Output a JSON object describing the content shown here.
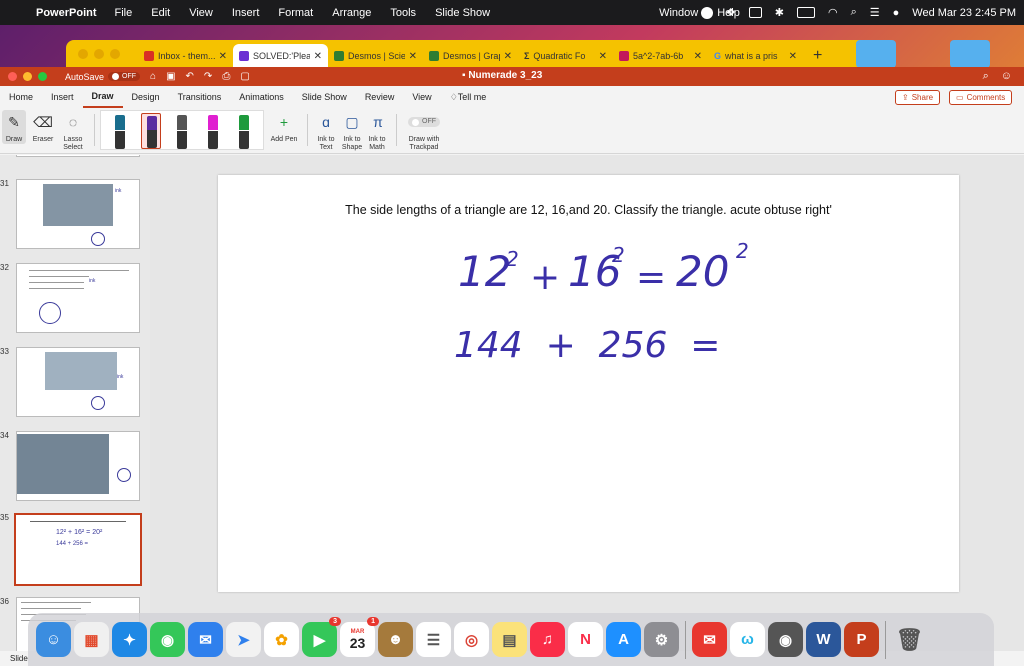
{
  "menubar": {
    "app_name": "PowerPoint",
    "menus": [
      "File",
      "Edit",
      "View",
      "Insert",
      "Format",
      "Arrange",
      "Tools",
      "Slide Show",
      "Window",
      "Help"
    ],
    "datetime": "Wed Mar 23  2:45 PM"
  },
  "browser": {
    "tabs": [
      {
        "label": "Inbox - them...",
        "fav_color": "#d93025"
      },
      {
        "label": "SOLVED:'Plea",
        "fav_color": "#6b2fd3"
      },
      {
        "label": "Desmos | Scie",
        "fav_color": "#2e7d32"
      },
      {
        "label": "Desmos | Grap",
        "fav_color": "#2e7d32"
      },
      {
        "label": "Quadratic Fo",
        "fav_color": "#333333"
      },
      {
        "label": "5a^2-7ab-6b",
        "fav_color": "#c2185b"
      },
      {
        "label": "what is a pris",
        "fav_color": "#4285f4"
      }
    ]
  },
  "ppt": {
    "autosave_label": "AutoSave",
    "autosave_state": "OFF",
    "doc_title": "Numerade 3_23",
    "ribbon_tabs": [
      "Home",
      "Insert",
      "Draw",
      "Design",
      "Transitions",
      "Animations",
      "Slide Show",
      "Review",
      "View"
    ],
    "active_tab": "Draw",
    "tell_me": "Tell me",
    "share_label": "Share",
    "comments_label": "Comments",
    "tools": {
      "draw": "Draw",
      "eraser": "Eraser",
      "lasso": "Lasso Select",
      "add_pen": "Add Pen",
      "ink_to_text": "Ink to Text",
      "ink_to_shape": "Ink to Shape",
      "ink_to_math": "Ink to Math",
      "trackpad": "Draw with Trackpad",
      "trackpad_state": "OFF"
    },
    "pens": [
      "#1a6e8e",
      "#5b2ca0",
      "#555555",
      "#e020d0",
      "#1e9a3c"
    ],
    "slide_numbers": [
      "31",
      "32",
      "33",
      "34",
      "35",
      "36"
    ],
    "status": "Slide"
  },
  "slide": {
    "question": "The side lengths of a triangle are 12, 16,and 20. Classify the triangle. acute obtuse right'",
    "line1": {
      "a": "12",
      "b": "16",
      "c": "20",
      "exp": "2"
    },
    "line2": "144  +  256  ="
  },
  "dock": {
    "calendar_month": "MAR",
    "calendar_day": "23",
    "badge_facetime": "3",
    "badge_calendar": "1"
  }
}
